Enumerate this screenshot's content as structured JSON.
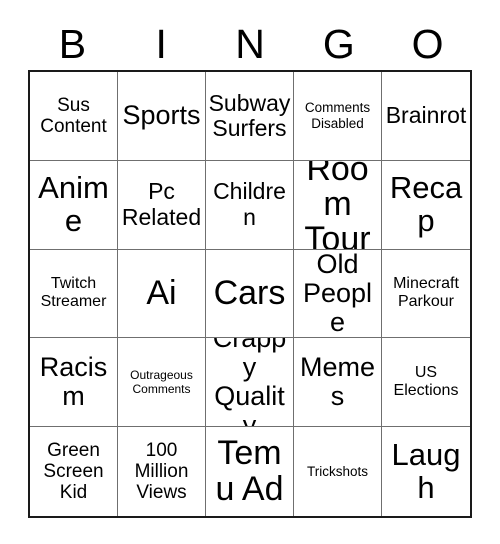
{
  "card": {
    "header_letters": [
      "B",
      "I",
      "N",
      "G",
      "O"
    ],
    "columns": 5,
    "rows": 5,
    "grid_border_color": "#1a1a1a",
    "cell_border_color": "#6f6f6f",
    "background_color": "#ffffff",
    "text_color": "#000000",
    "cells": [
      {
        "text": "Sus Content",
        "size": "lg"
      },
      {
        "text": "Sports",
        "size": "2xl"
      },
      {
        "text": "Subway Surfers",
        "size": "xl"
      },
      {
        "text": "Comments Disabled",
        "size": "sm"
      },
      {
        "text": "Brainrot",
        "size": "xl"
      },
      {
        "text": "Anime",
        "size": "3xl"
      },
      {
        "text": "Pc Related",
        "size": "xl"
      },
      {
        "text": "Children",
        "size": "xl"
      },
      {
        "text": "Room Tour",
        "size": "4xl"
      },
      {
        "text": "Recap",
        "size": "3xl"
      },
      {
        "text": "Twitch Streamer",
        "size": "md"
      },
      {
        "text": "Ai",
        "size": "4xl"
      },
      {
        "text": "Cars",
        "size": "4xl"
      },
      {
        "text": "Old People",
        "size": "2xl"
      },
      {
        "text": "Minecraft Parkour",
        "size": "md"
      },
      {
        "text": "Racism",
        "size": "2xl"
      },
      {
        "text": "Outrageous Comments",
        "size": "xs"
      },
      {
        "text": "Crappy Quality",
        "size": "2xl"
      },
      {
        "text": "Memes",
        "size": "2xl"
      },
      {
        "text": "US Elections",
        "size": "md"
      },
      {
        "text": "Green Screen Kid",
        "size": "lg"
      },
      {
        "text": "100 Million Views",
        "size": "lg"
      },
      {
        "text": "Temu Ad",
        "size": "4xl"
      },
      {
        "text": "Trickshots",
        "size": "sm"
      },
      {
        "text": "Laugh",
        "size": "3xl"
      }
    ]
  }
}
